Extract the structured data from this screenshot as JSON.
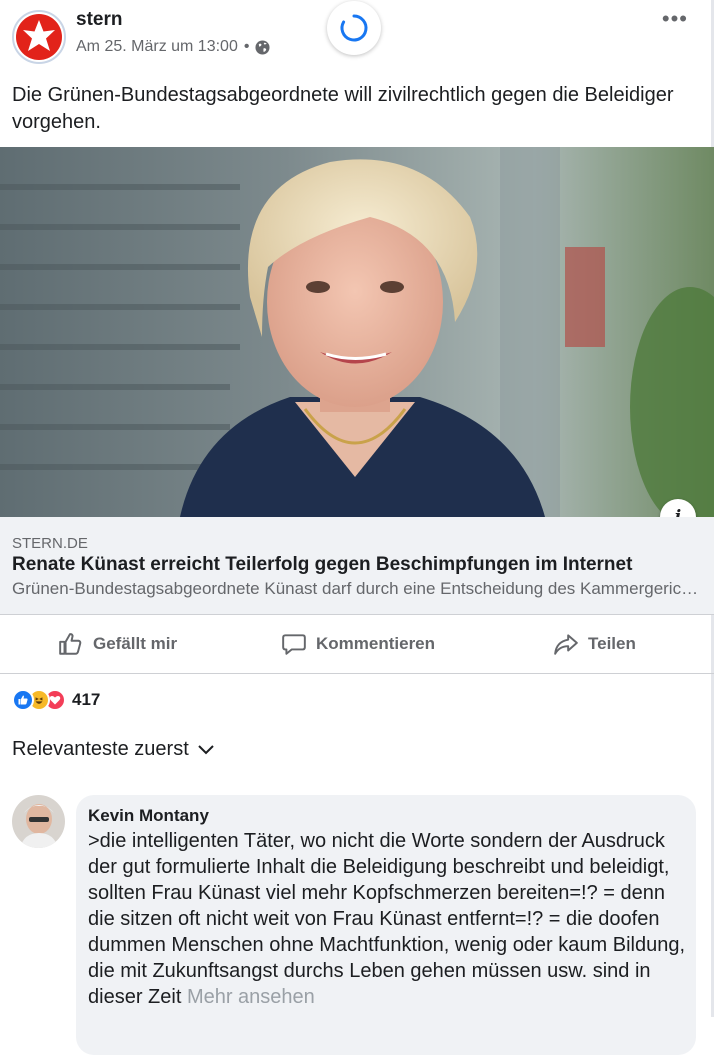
{
  "header": {
    "page_name": "stern",
    "timestamp": "Am 25. März um 13:00",
    "separator": "•",
    "more_label": "•••",
    "privacy_icon": "globe-icon"
  },
  "post": {
    "text": "Die Grünen-Bundestagsabgeordnete will zivilrechtlich gegen die Beleidiger vorgehen."
  },
  "link_preview": {
    "domain": "STERN.DE",
    "title": "Renate Künast erreicht Teilerfolg gegen Beschimpfungen im Internet",
    "description": "Grünen-Bundestagsabgeordnete Künast darf durch eine Entscheidung des Kammergerichts...",
    "info_label": "i"
  },
  "actions": {
    "like": "Gefällt mir",
    "comment": "Kommentieren",
    "share": "Teilen"
  },
  "reactions": {
    "count": "417",
    "types": [
      "like",
      "haha",
      "love"
    ],
    "colors": {
      "like": "#1877f2",
      "haha": "#f7b928",
      "love": "#f33e58"
    }
  },
  "comments_sort": {
    "label": "Relevanteste zuerst"
  },
  "comment": {
    "author": "Kevin Montany",
    "text": ">die intelligenten Täter, wo nicht die Worte sondern der Ausdruck der gut formulierte Inhalt die Beleidigung beschreibt und beleidigt, sollten Frau Künast viel mehr Kopfschmerzen bereiten=!? = denn die sitzen oft nicht weit von Frau Künast entfernt=!? = die  doofen dummen Menschen ohne Machtfunktion, wenig oder kaum Bildung, die mit Zukunftsangst durchs Leben gehen müssen usw. sind in dieser Zeit ",
    "more": "Mehr ansehen"
  },
  "colors": {
    "accent": "#1877f2",
    "brand_red": "#e2231a",
    "text_secondary": "#65676b",
    "surface": "#f0f2f5"
  }
}
